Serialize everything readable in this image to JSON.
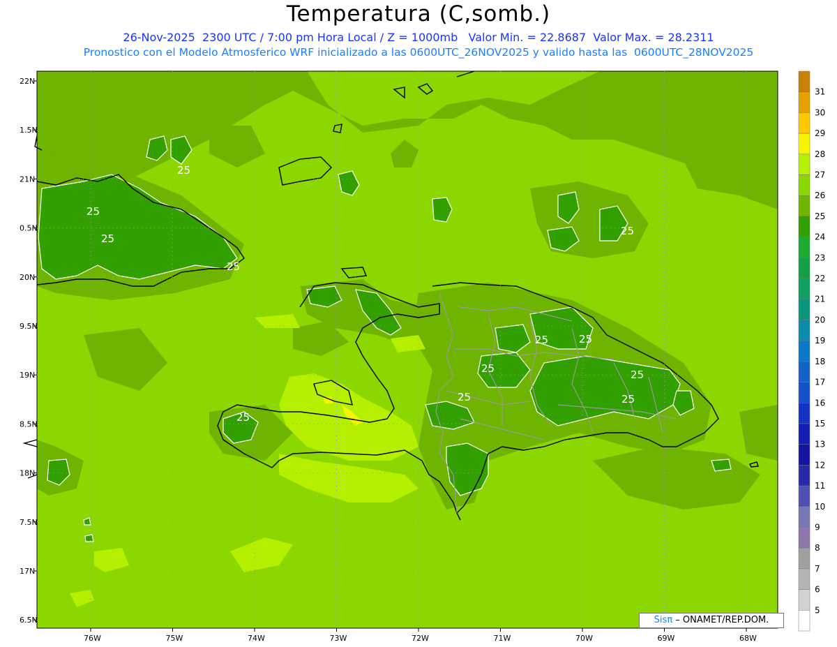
{
  "header": {
    "title": "Temperatura (C,somb.)",
    "line1": "26-Nov-2025  2300 UTC / 7:00 pm Hora Local / Z = 1000mb   Valor Min. = 22.8687  Valor Max. = 28.2311",
    "line2": "Pronostico con el Modelo Atmosferico WRF inicializado a las 0600UTC_26NOV2025 y valido hasta las  0600UTC_28NOV2025"
  },
  "credit": {
    "brand": "Sis",
    "pi": "π",
    "org": "– ONAMET/REP.DOM."
  },
  "axes": {
    "lat_labels": [
      "22N",
      "1.5N",
      "21N",
      "0.5N",
      "20N",
      "9.5N",
      "19N",
      "8.5N",
      "18N",
      "7.5N",
      "17N",
      "6.5N"
    ],
    "lon_labels": [
      "76W",
      "75W",
      "74W",
      "73W",
      "72W",
      "71W",
      "70W",
      "69W",
      "68W"
    ]
  },
  "contour_labels": [
    "25",
    "25",
    "25",
    "25",
    "25",
    "25",
    "25",
    "25",
    "25",
    "25",
    "25",
    "25"
  ],
  "colorbar": {
    "levels": [
      "31",
      "30",
      "29",
      "28",
      "27",
      "26",
      "25",
      "24",
      "23",
      "22",
      "21",
      "20",
      "19",
      "18",
      "17",
      "16",
      "15",
      "13",
      "12",
      "11",
      "10",
      "9",
      "8",
      "7",
      "6",
      "5"
    ],
    "colors": [
      "#c8820a",
      "#e6a000",
      "#ffc800",
      "#f5f500",
      "#b4f000",
      "#8cd700",
      "#6eb400",
      "#32a000",
      "#1eaa32",
      "#14a046",
      "#10a064",
      "#0a9678",
      "#0a8caa",
      "#0a78c8",
      "#1464c8",
      "#1450c8",
      "#1432c8",
      "#141eb4",
      "#1414a0",
      "#2828aa",
      "#5050b4",
      "#7878b4",
      "#8c78aa",
      "#a0a0a0",
      "#b4b4b4",
      "#d2d2d2",
      "#ffffff"
    ]
  },
  "colors": {
    "background_field": "#8cd700",
    "band_26": "#6eb400",
    "band_24": "#32a000",
    "band_27": "#b4f000",
    "band_28": "#f5f500",
    "coast": "#000000",
    "borders": "#999999"
  }
}
